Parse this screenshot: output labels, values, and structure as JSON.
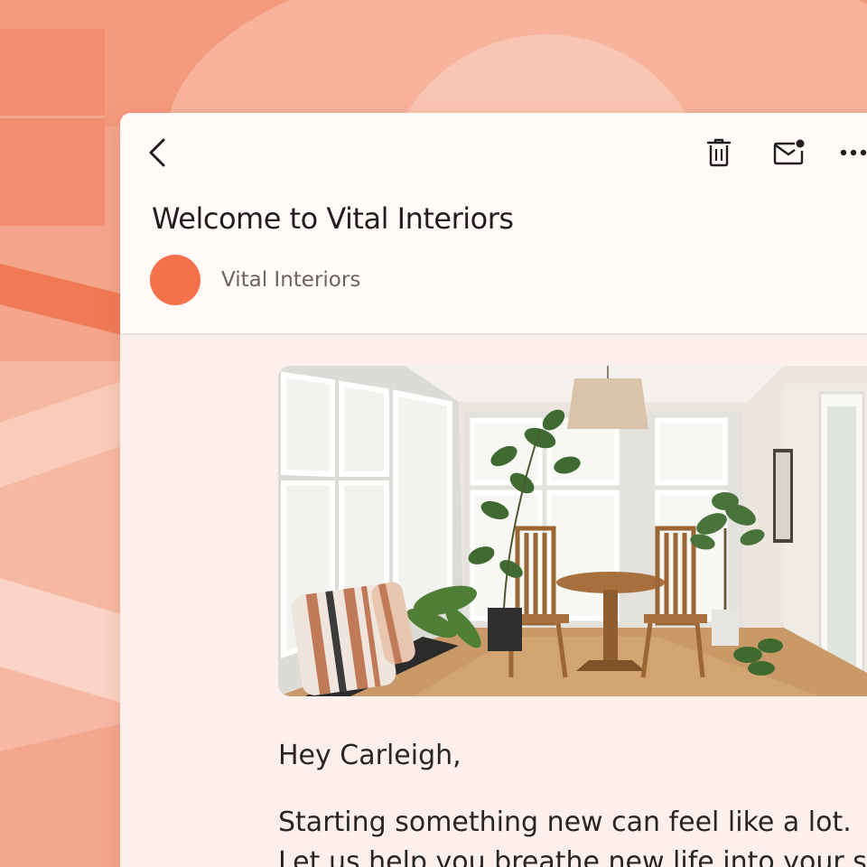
{
  "colors": {
    "accent": "#f5714b",
    "background": "#f4a58c",
    "header_bg": "#fffaf8",
    "body_bg": "#fdf0ec",
    "text_primary": "#1f1f1f",
    "text_secondary": "#6b6561"
  },
  "toolbar": {
    "back_icon": "chevron-left-icon",
    "delete_icon": "trash-icon",
    "mark_unread_icon": "mail-unread-icon",
    "more_icon": "more-horizontal-icon"
  },
  "email": {
    "subject": "Welcome to Vital Interiors",
    "sender": {
      "name": "Vital Interiors",
      "avatar_color": "#f5714b"
    },
    "hero_image": {
      "icon": "sunroom-photo"
    },
    "greeting": "Hey Carleigh,",
    "body_lines": [
      "Starting something new can feel like a lot.",
      "Let us help you breathe new life into your space."
    ]
  }
}
